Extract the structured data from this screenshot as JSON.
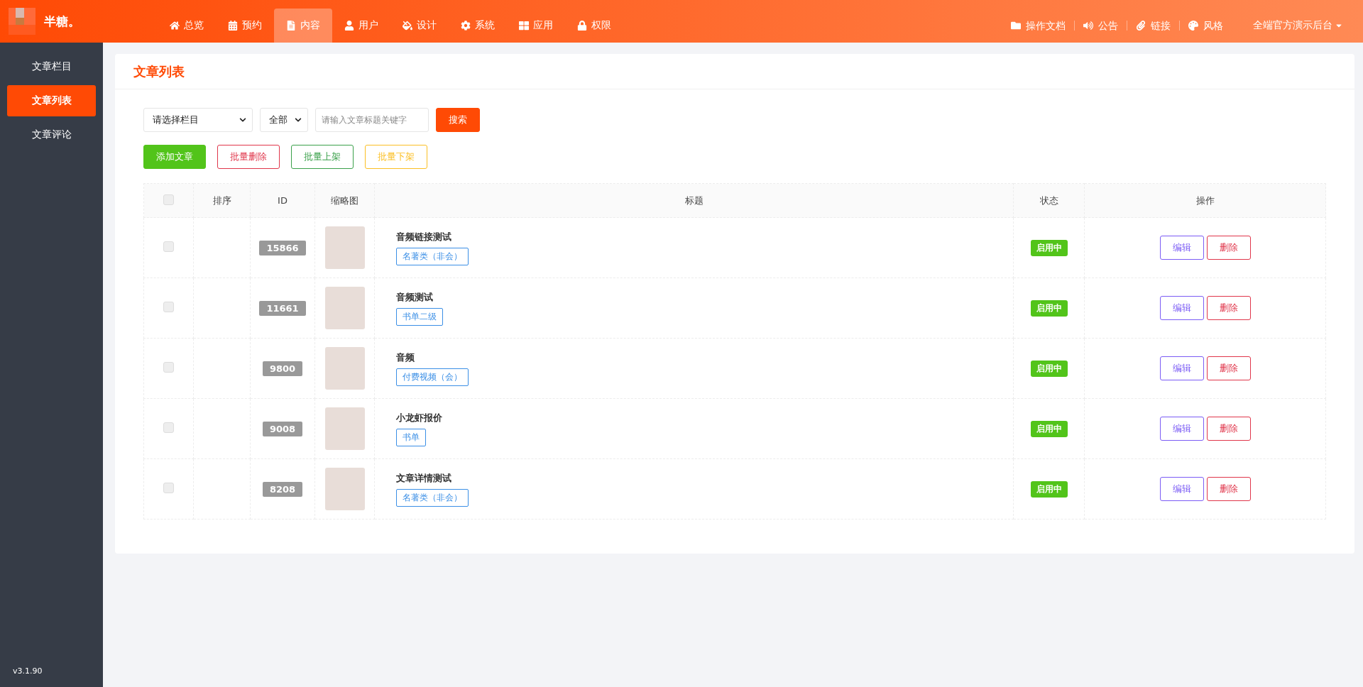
{
  "brand": {
    "name": "半糖。"
  },
  "nav": [
    {
      "label": "总览",
      "selected": false
    },
    {
      "label": "预约",
      "selected": false
    },
    {
      "label": "内容",
      "selected": true
    },
    {
      "label": "用户",
      "selected": false
    },
    {
      "label": "设计",
      "selected": false
    },
    {
      "label": "系统",
      "selected": false
    },
    {
      "label": "应用",
      "selected": false
    },
    {
      "label": "权限",
      "selected": false
    }
  ],
  "top_links": [
    "操作文档",
    "公告",
    "链接",
    "风格"
  ],
  "account": "全端官方演示后台",
  "sidebar": {
    "items": [
      {
        "label": "文章栏目",
        "selected": false
      },
      {
        "label": "文章列表",
        "selected": true
      },
      {
        "label": "文章评论",
        "selected": false
      }
    ],
    "version": "v3.1.90"
  },
  "page_title": "文章列表",
  "filters": {
    "category": "请选择栏目",
    "status": "全部",
    "search_placeholder": "请输入文章标题关键字",
    "search_button": "搜索"
  },
  "actions": [
    {
      "label": "添加文章",
      "kind": "solid",
      "color": "#52c41a"
    },
    {
      "label": "批量删除",
      "kind": "outline",
      "color": "#e0364b"
    },
    {
      "label": "批量上架",
      "kind": "outline",
      "color": "#3aa04a"
    },
    {
      "label": "批量下架",
      "kind": "outline",
      "color": "#fbbf24"
    }
  ],
  "table": {
    "select_all": {
      "checked": false
    },
    "columns": [
      "排序",
      "ID",
      "缩略图",
      "标题",
      "状态",
      "操作"
    ],
    "rows": [
      {
        "checked": false,
        "id": "15866",
        "title": "音频链接测试",
        "tag": "名著类（非会）",
        "status": "启用中",
        "edit": "编辑",
        "delete": "删除"
      },
      {
        "checked": false,
        "id": "11661",
        "title": "音频测试",
        "tag": "书单二级",
        "status": "启用中",
        "edit": "编辑",
        "delete": "删除"
      },
      {
        "checked": false,
        "id": "9800",
        "title": "音频",
        "tag": "付费视频（会）",
        "status": "启用中",
        "edit": "编辑",
        "delete": "删除"
      },
      {
        "checked": false,
        "id": "9008",
        "title": "小龙虾报价",
        "tag": "书单",
        "status": "启用中",
        "edit": "编辑",
        "delete": "删除"
      },
      {
        "checked": false,
        "id": "8208",
        "title": "文章详情测试",
        "tag": "名著类（非会）",
        "status": "启用中",
        "edit": "编辑",
        "delete": "删除"
      }
    ]
  }
}
